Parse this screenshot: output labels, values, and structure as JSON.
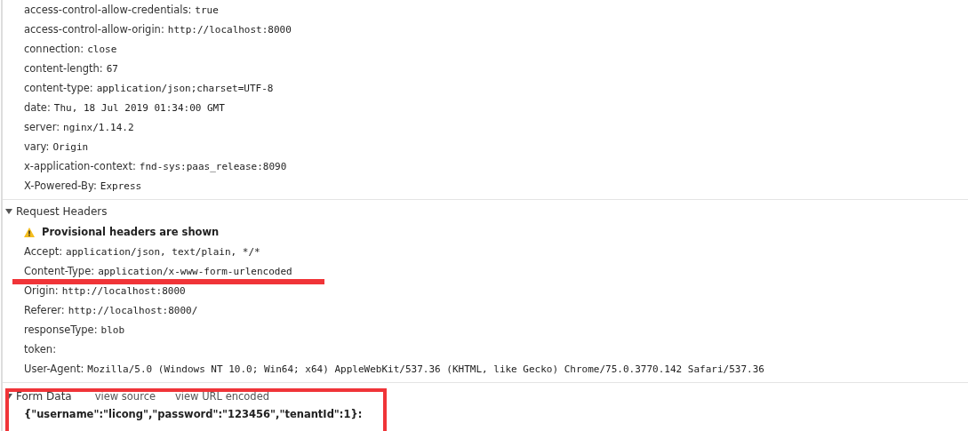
{
  "response_headers": [
    {
      "name": "access-control-allow-credentials:",
      "value": "true",
      "underlined": false
    },
    {
      "name": "access-control-allow-origin:",
      "value": "http://localhost:8000",
      "underlined": false
    },
    {
      "name": "connection:",
      "value": "close",
      "underlined": false
    },
    {
      "name": "content-length:",
      "value": "67",
      "underlined": false
    },
    {
      "name": "content-type:",
      "value": "application/json;charset=UTF-8",
      "underlined": false
    },
    {
      "name": "date:",
      "value": "Thu, 18 Jul 2019 01:34:00 GMT",
      "underlined": false
    },
    {
      "name": "server:",
      "value": "nginx/1.14.2",
      "underlined": false
    },
    {
      "name": "vary:",
      "value": "Origin",
      "underlined": false
    },
    {
      "name": "x-application-context:",
      "value": "fnd-sys:paas_release:8090",
      "underlined": false
    },
    {
      "name": "X-Powered-By:",
      "value": "Express",
      "underlined": false
    }
  ],
  "request_headers": {
    "title": "Request Headers",
    "warning": "Provisional headers are shown",
    "headers": [
      {
        "name": "Accept:",
        "value": "application/json, text/plain, */*",
        "underlined": false
      },
      {
        "name": "Content-Type:",
        "value": "application/x-www-form-urlencoded",
        "underlined": true
      },
      {
        "name": "Origin:",
        "value": "http://localhost:8000",
        "underlined": false
      },
      {
        "name": "Referer:",
        "value": "http://localhost:8000/",
        "underlined": false
      },
      {
        "name": "responseType:",
        "value": "blob",
        "underlined": false
      },
      {
        "name": "token:",
        "underlined": false
      },
      {
        "name": "User-Agent:",
        "value": "Mozilla/5.0 (Windows NT 10.0; Win64; x64) AppleWebKit/537.36 (KHTML, like Gecko) Chrome/75.0.3770.142 Safari/537.36",
        "underlined": false
      }
    ]
  },
  "form_data": {
    "title": "Form Data",
    "boxed": true,
    "links": [
      "view source",
      "view URL encoded"
    ],
    "body": "{\"username\":\"licong\",\"password\":\"123456\",\"tenantId\":1}:"
  }
}
